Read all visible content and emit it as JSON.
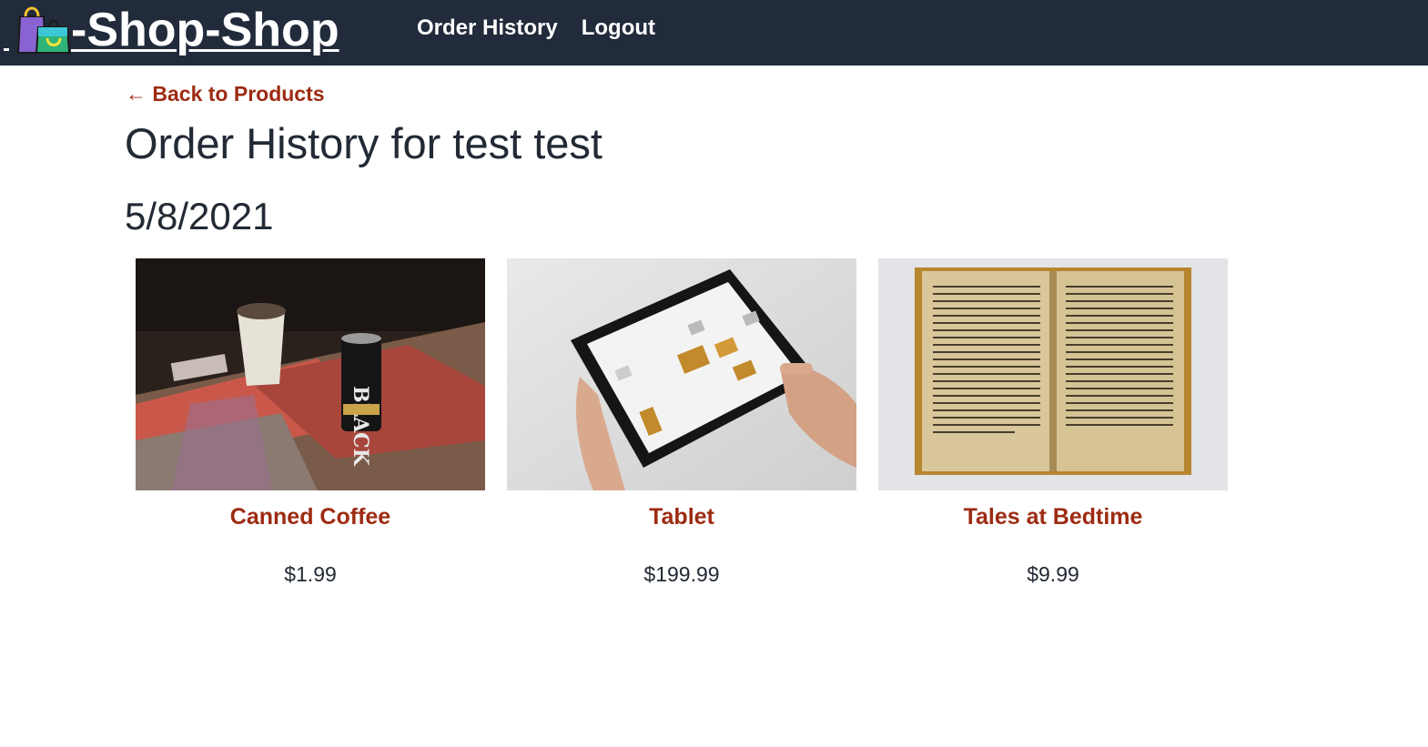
{
  "navbar": {
    "brand_text": "-Shop-Shop",
    "brand_icon": "shopping-bags-icon",
    "links": [
      {
        "label": "Order History"
      },
      {
        "label": "Logout"
      }
    ]
  },
  "main": {
    "back_link": "← Back to Products",
    "title": "Order History for test test",
    "order": {
      "date": "5/8/2021",
      "items": [
        {
          "name": "Canned Coffee",
          "price": "$1.99",
          "image": "canned-coffee-photo"
        },
        {
          "name": "Tablet",
          "price": "$199.99",
          "image": "tablet-photo"
        },
        {
          "name": "Tales at Bedtime",
          "price": "$9.99",
          "image": "open-book-photo"
        }
      ]
    }
  },
  "colors": {
    "navbar_bg": "#222b3b",
    "accent": "#9d2b12",
    "text": "#222a35"
  }
}
